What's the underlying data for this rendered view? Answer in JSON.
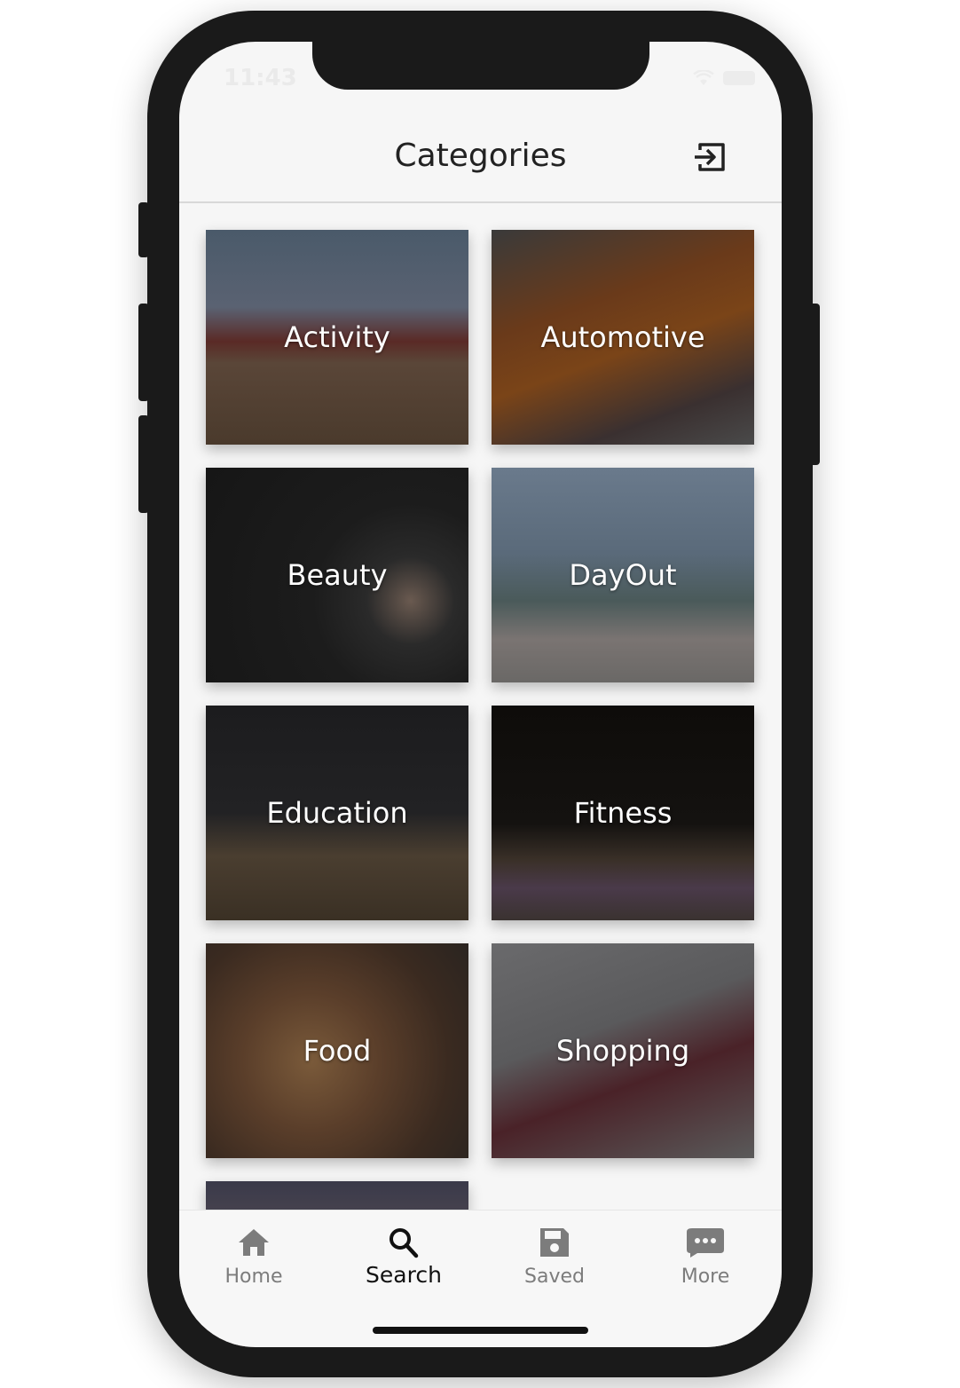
{
  "status_bar": {
    "time": "11:43"
  },
  "header": {
    "title": "Categories",
    "logout_icon": "logout-icon"
  },
  "categories": [
    {
      "label": "Activity",
      "color": "#5a4a3c"
    },
    {
      "label": "Automotive",
      "color": "#5c3a22"
    },
    {
      "label": "Beauty",
      "color": "#1f1f1f"
    },
    {
      "label": "DayOut",
      "color": "#5a6a7a"
    },
    {
      "label": "Education",
      "color": "#2a2622"
    },
    {
      "label": "Fitness",
      "color": "#1a1714"
    },
    {
      "label": "Food",
      "color": "#4a3a28"
    },
    {
      "label": "Shopping",
      "color": "#5a5456"
    }
  ],
  "tabbar": {
    "tabs": [
      {
        "label": "Home",
        "icon": "home-icon",
        "active": false
      },
      {
        "label": "Search",
        "icon": "search-icon",
        "active": true
      },
      {
        "label": "Saved",
        "icon": "save-icon",
        "active": false
      },
      {
        "label": "More",
        "icon": "more-icon",
        "active": false
      }
    ]
  }
}
